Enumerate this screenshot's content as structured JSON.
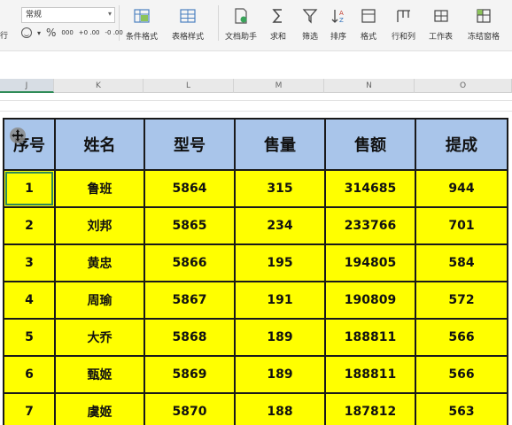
{
  "ribbon": {
    "number_format": "常规",
    "edge_label": "行",
    "percent": "%",
    "thousands": "000",
    "dec_increase": "+0 .00",
    "dec_decrease": "-0 .00",
    "tools": {
      "conditional_format": "条件格式",
      "table_style": "表格样式",
      "doc_helper": "文档助手",
      "sum": "求和",
      "filter": "筛选",
      "sort": "排序",
      "format": "格式",
      "row_col": "行和列",
      "worksheet": "工作表",
      "freeze": "冻结窗格"
    }
  },
  "columns": [
    "J",
    "K",
    "L",
    "M",
    "N",
    "O"
  ],
  "selected_column": "J",
  "table": {
    "headers": [
      "序号",
      "姓名",
      "型号",
      "售量",
      "售额",
      "提成"
    ],
    "rows": [
      [
        "1",
        "鲁班",
        "5864",
        "315",
        "314685",
        "944"
      ],
      [
        "2",
        "刘邦",
        "5865",
        "234",
        "233766",
        "701"
      ],
      [
        "3",
        "黄忠",
        "5866",
        "195",
        "194805",
        "584"
      ],
      [
        "4",
        "周瑜",
        "5867",
        "191",
        "190809",
        "572"
      ],
      [
        "5",
        "大乔",
        "5868",
        "189",
        "188811",
        "566"
      ],
      [
        "6",
        "甄姬",
        "5869",
        "189",
        "188811",
        "566"
      ],
      [
        "7",
        "虞姬",
        "5870",
        "188",
        "187812",
        "563"
      ]
    ]
  },
  "colors": {
    "header_fill": "#a9c5ea",
    "cell_fill": "#ffff00",
    "selection": "#2e8b57"
  },
  "cursor_icon": "move-cursor-icon"
}
